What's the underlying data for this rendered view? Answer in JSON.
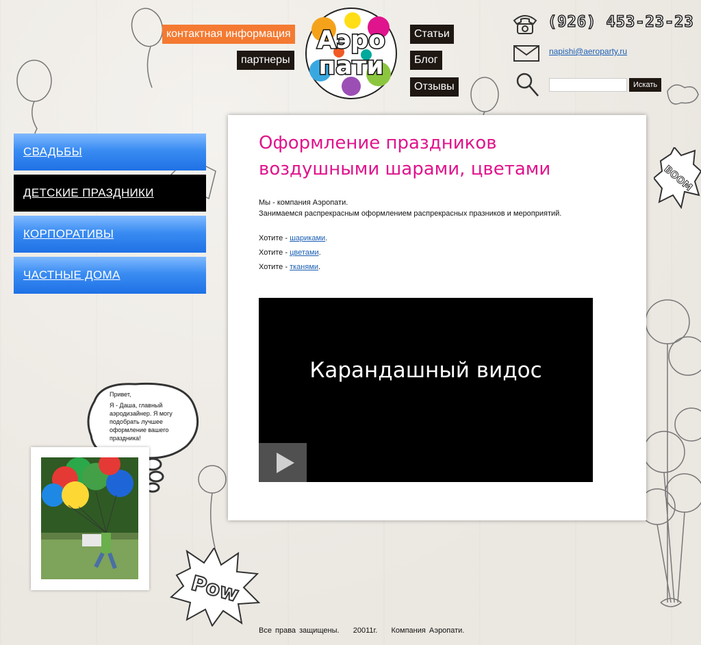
{
  "nav": {
    "contact": "контактная информация",
    "partners": "партнеры",
    "articles": "Статьи",
    "blog": "Блог",
    "reviews": "Отзывы"
  },
  "logo": {
    "line1": "Аэро",
    "line2": "пати"
  },
  "header": {
    "phone": "(926) 453-23-23",
    "email": "napishi@aeroparty.ru",
    "search_button": "Искать",
    "search_value": ""
  },
  "menu": [
    {
      "label": "СВАДЬБЫ",
      "active": false
    },
    {
      "label": "ДЕТСКИЕ ПРАЗДНИКИ",
      "active": true
    },
    {
      "label": "КОРПОРАТИВЫ",
      "active": false
    },
    {
      "label": "ЧАСТНЫЕ ДОМА",
      "active": false
    }
  ],
  "content": {
    "title_line1": "Оформление праздников",
    "title_line2": "воздушными шарами, цветами",
    "intro_line1": "Мы - компания Аэропати.",
    "intro_line2": "Занимаемся распрекрасным оформлением распрекрасных празников и мероприятий.",
    "want_prefix": "Хотите - ",
    "want_items": [
      "шариками",
      "цветами",
      "тканями"
    ],
    "want_suffix": "."
  },
  "video": {
    "title": "Карандашный видос"
  },
  "bubble": {
    "greeting": "Привет,",
    "text": "Я - Даша, главный аэродизайнер. Я могу подобрать лучшее оформление вашего праздника!"
  },
  "decor": {
    "pow": "Pow",
    "boom": "BOOM"
  },
  "footer": {
    "text": "Все права защищены.    20011г.    Компания Аэропати."
  },
  "colors": {
    "accent": "#e0148c",
    "menu_blue": "#1f71e6",
    "nav_orange": "#f47a32",
    "nav_dark": "#1e1712"
  }
}
